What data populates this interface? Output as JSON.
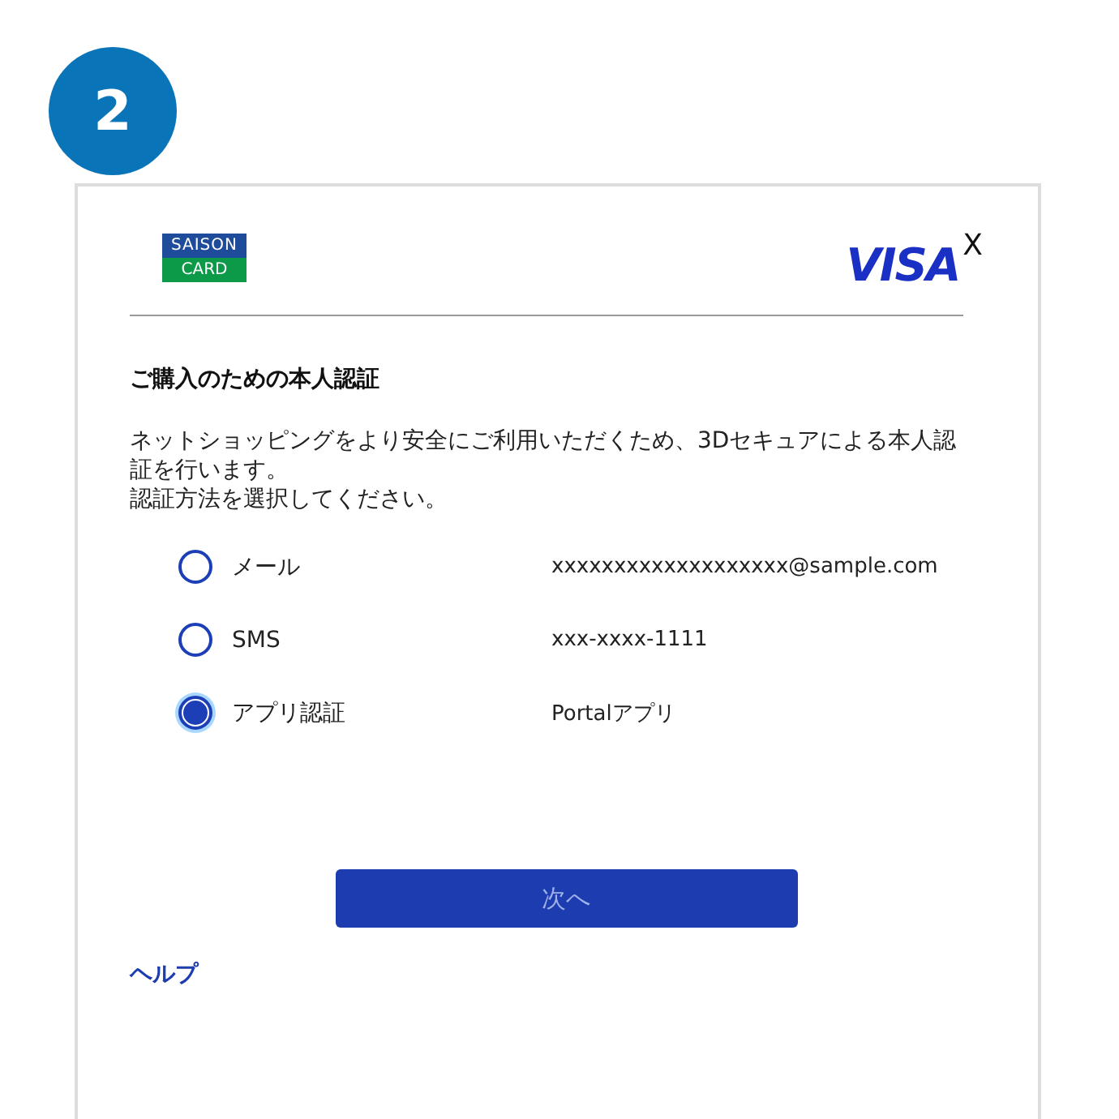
{
  "step": {
    "number": "2"
  },
  "header": {
    "issuer_logo": {
      "top": "SAISON",
      "bottom": "CARD"
    },
    "brand_logo": "VISA",
    "close": "X"
  },
  "title": "ご購入のための本人認証",
  "description": [
    "ネットショッピングをより安全にご利用いただくため、3Dセキュアによる本人認証を行います。",
    "認証方法を選択してください。"
  ],
  "methods": [
    {
      "label": "メール",
      "value": "xxxxxxxxxxxxxxxxxxx@sample.com",
      "selected": false
    },
    {
      "label": "SMS",
      "value": "xxx-xxxx-1111",
      "selected": false
    },
    {
      "label": "アプリ認証",
      "value": "Portalアプリ",
      "selected": true
    }
  ],
  "next_button": "次へ",
  "help_link": "ヘルプ"
}
